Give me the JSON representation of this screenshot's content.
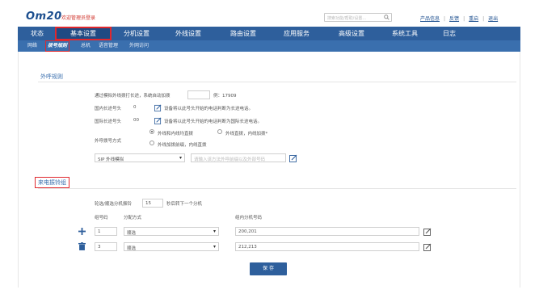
{
  "header": {
    "logo": "Om20",
    "welcome": "欢迎管理员登录",
    "search_placeholder": "搜索功能/帮助/设置...",
    "links": [
      "产品信息",
      "反馈",
      "重启",
      "退出"
    ]
  },
  "nav": {
    "items": [
      "状态",
      "基本设置",
      "分机设置",
      "外线设置",
      "路由设置",
      "应用服务",
      "高级设置",
      "系统工具",
      "日志"
    ],
    "active": "基本设置"
  },
  "subnav": {
    "items": [
      "网络",
      "拨号规则",
      "总机",
      "语音管理",
      "外网访问"
    ],
    "active": "拨号规则"
  },
  "outbound": {
    "title": "外呼规则",
    "auto_prefix_label": "通过模拟外线拨打长途，系统自动加拨",
    "auto_prefix_value": "",
    "auto_prefix_example": "例：17909",
    "domestic_label": "国内长途号头",
    "domestic_value": "0",
    "domestic_note": "设备将以此号头开始的电话判断为长途电话。",
    "intl_label": "国际长途号头",
    "intl_value": "00",
    "intl_note": "设备将以此号头开始的电话判断为国际长途电话。",
    "dial_mode_label": "外呼拨号方式",
    "dial_mode_options": [
      "外线和内线均直拨",
      "外线直拨，内线加拨*",
      "外线加拨前缀，内线直拨"
    ],
    "trunk_select": "SIP 外线模拟",
    "trunk_placeholder": "请输入该方法外呼前缀以及外部号码"
  },
  "hunt": {
    "title": "来电振铃组",
    "ring_label": "轮选/顺选分机振铃",
    "ring_seconds": "15",
    "ring_suffix": "秒后转下一个分机",
    "col_group": "组号码",
    "col_mode": "分配方式",
    "col_members": "组内分机号码",
    "rows": [
      {
        "group": "1",
        "mode": "顺选",
        "members": "200,201"
      },
      {
        "group": "3",
        "mode": "顺选",
        "members": "212,213"
      }
    ]
  },
  "save_label": "保 存",
  "colors": {
    "primary": "#2e5f9c",
    "highlight": "#e0282e"
  }
}
